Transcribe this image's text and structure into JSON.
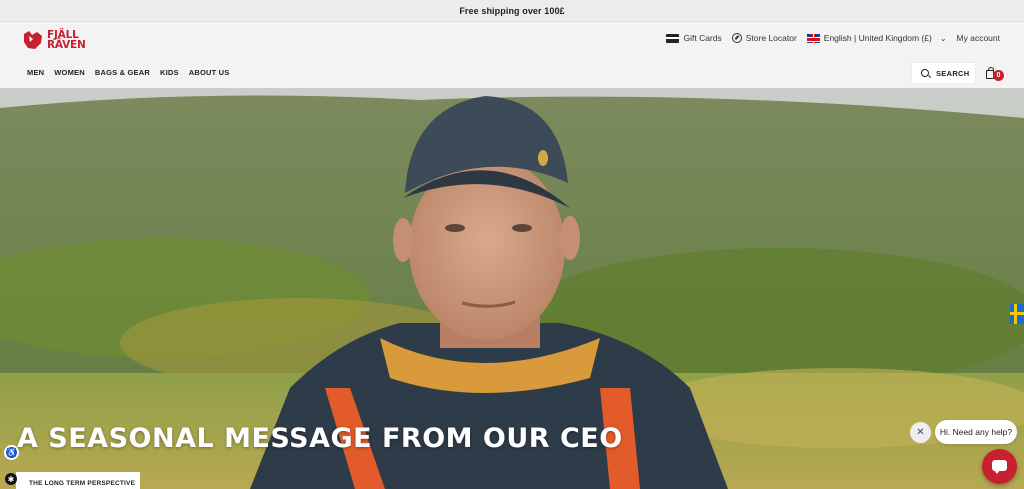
{
  "announcement": {
    "text": "Free shipping over 100£"
  },
  "brand": {
    "line1": "FJÄLL",
    "line2": "RÄVEN",
    "color": "#c8202f",
    "icon": "fox-logo-icon"
  },
  "utility": {
    "gift_cards": "Gift Cards",
    "store_locator": "Store Locator",
    "language": "English | United Kingdom (£)",
    "account": "My account"
  },
  "nav": {
    "items": [
      "MEN",
      "WOMEN",
      "BAGS & GEAR",
      "KIDS",
      "ABOUT US"
    ]
  },
  "search": {
    "label": "SEARCH"
  },
  "cart": {
    "count": "0"
  },
  "hero": {
    "headline": "A SEASONAL MESSAGE FROM OUR CEO",
    "cta": "THE LONG TERM PERSPECTIVE"
  },
  "chat": {
    "prompt": "Hi. Need any help?",
    "close": "✕"
  },
  "colors": {
    "accent": "#c8202f",
    "background": "#f3f3f3"
  }
}
